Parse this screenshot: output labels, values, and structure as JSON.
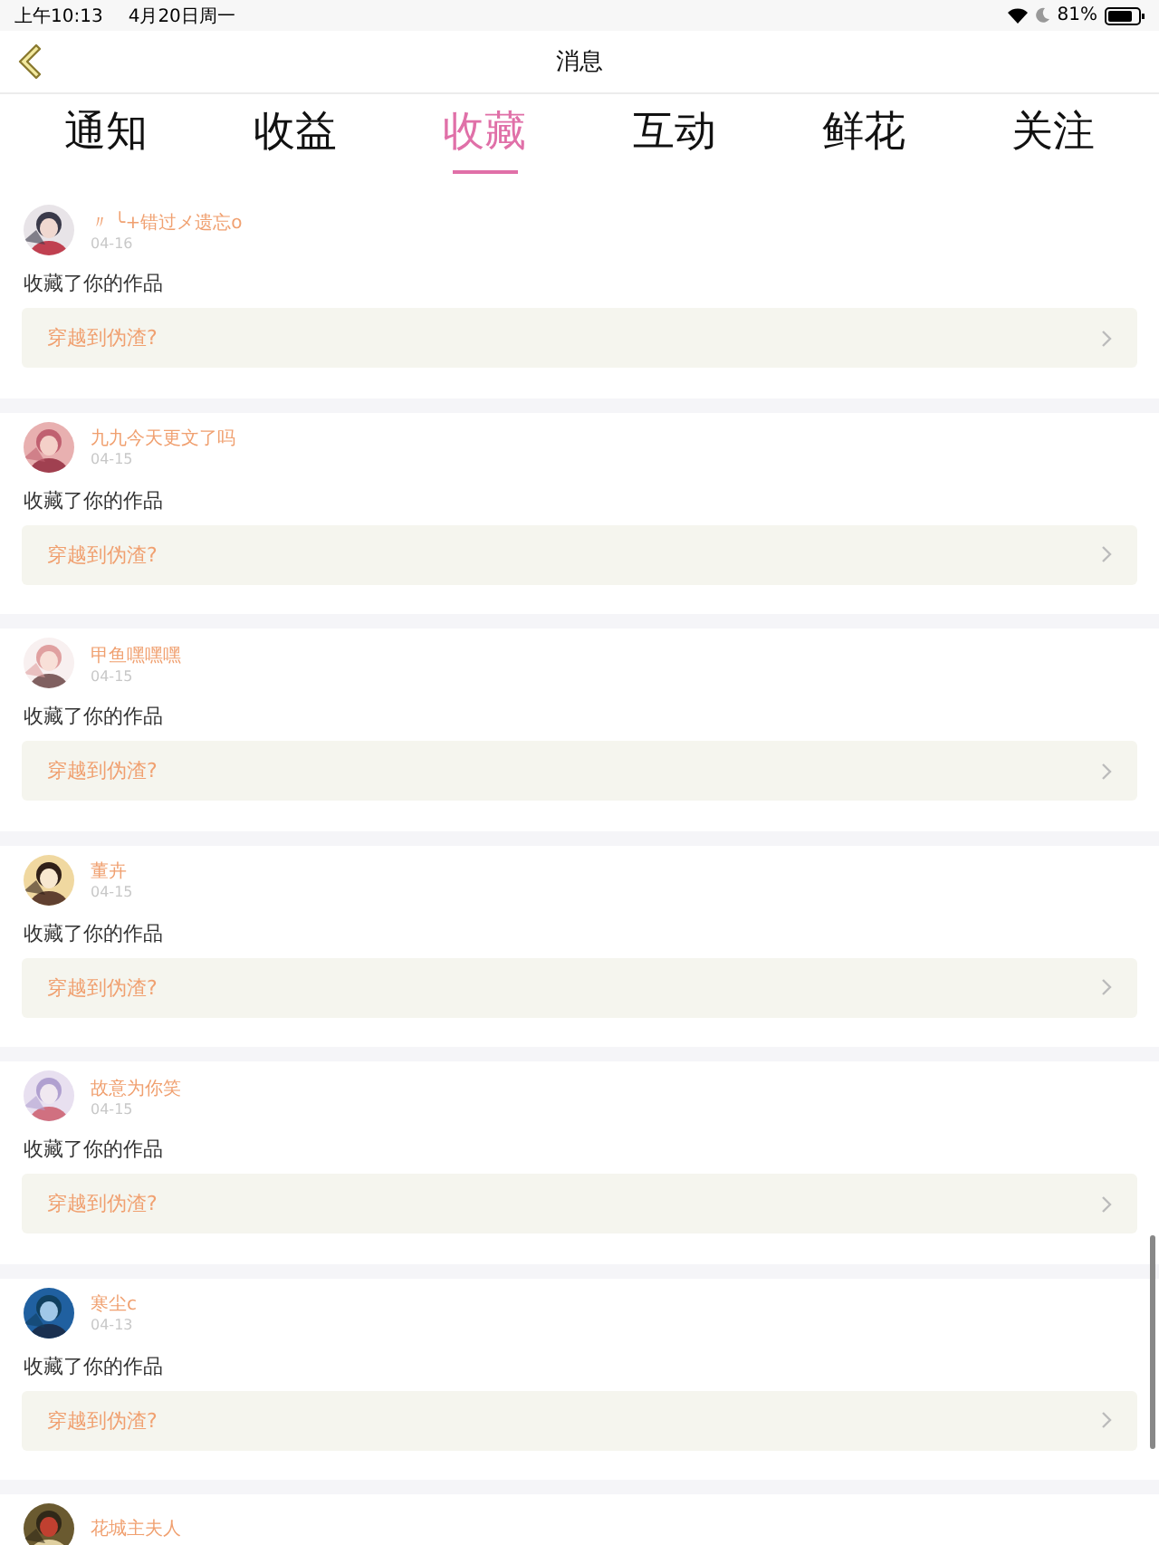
{
  "status_bar": {
    "time": "上午10:13",
    "date": "4月20日周一",
    "battery": "81%"
  },
  "nav": {
    "title": "消息"
  },
  "tabs": [
    {
      "label": "通知",
      "selected": false
    },
    {
      "label": "收益",
      "selected": false
    },
    {
      "label": "收藏",
      "selected": true
    },
    {
      "label": "互动",
      "selected": false
    },
    {
      "label": "鲜花",
      "selected": false
    },
    {
      "label": "关注",
      "selected": false
    }
  ],
  "messages": [
    {
      "user": "〃 ╰+错过メ遗忘o",
      "date": "04-16",
      "action": "收藏了你的作品",
      "work": "穿越到伪渣?"
    },
    {
      "user": "九九今天更文了吗",
      "date": "04-15",
      "action": "收藏了你的作品",
      "work": "穿越到伪渣?"
    },
    {
      "user": "甲鱼嘿嘿嘿",
      "date": "04-15",
      "action": "收藏了你的作品",
      "work": "穿越到伪渣?"
    },
    {
      "user": "董卉",
      "date": "04-15",
      "action": "收藏了你的作品",
      "work": "穿越到伪渣?"
    },
    {
      "user": "故意为你笑",
      "date": "04-15",
      "action": "收藏了你的作品",
      "work": "穿越到伪渣?"
    },
    {
      "user": "寒尘c",
      "date": "04-13",
      "action": "收藏了你的作品",
      "work": "穿越到伪渣?"
    },
    {
      "user": "花城主夫人"
    }
  ]
}
